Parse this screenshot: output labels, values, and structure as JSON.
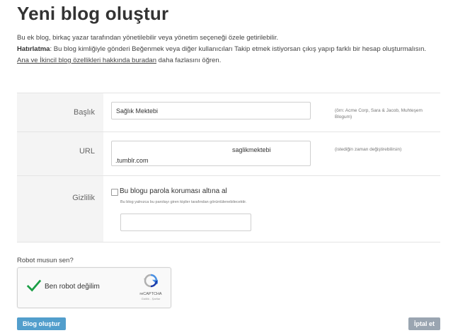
{
  "page": {
    "title": "Yeni blog oluştur",
    "intro_line1": "Bu ek blog, birkaç yazar tarafından yönetilebilir veya yönetim seçeneği özele getirilebilir.",
    "reminder_label": "Hatırlatma",
    "reminder_text": ": Bu blog kimliğiyle gönderi Beğenmek veya diğer kullanıcıları Takip etmek istiyorsan çıkış yapıp farklı bir hesap oluşturmalısın.",
    "features_link": "Ana ve İkincil blog özellikleri hakkında buradan",
    "features_suffix": " daha fazlasını öğren."
  },
  "form": {
    "title_label": "Başlık",
    "title_value": "Sağlık Mektebi",
    "title_hint": "(örn: Acme Corp, Sara & Jacob, Muhteşem Blogum)",
    "url_label": "URL",
    "url_value": "saglikmektebi",
    "url_suffix": ".tumblr.com",
    "url_hint": "(istediğin zaman değiştirebilirsin)",
    "privacy_label": "Gizlilik",
    "privacy_checkbox_label": "Bu blogu parola koruması altına al",
    "privacy_note": "Bu blog yalnızca bu parolayı giren kişiler tarafından görüntülenebilecektir.",
    "password_value": ""
  },
  "captcha": {
    "question": "Robot musun sen?",
    "label": "Ben robot değilim",
    "brand": "reCAPTCHA",
    "terms": "Gizlilik - Şartlar",
    "checked": true
  },
  "buttons": {
    "create": "Blog oluştur",
    "cancel": "İptal et"
  },
  "colors": {
    "primary": "#529ecc",
    "cancel": "#9aa5b1",
    "check": "#1a9e45"
  }
}
